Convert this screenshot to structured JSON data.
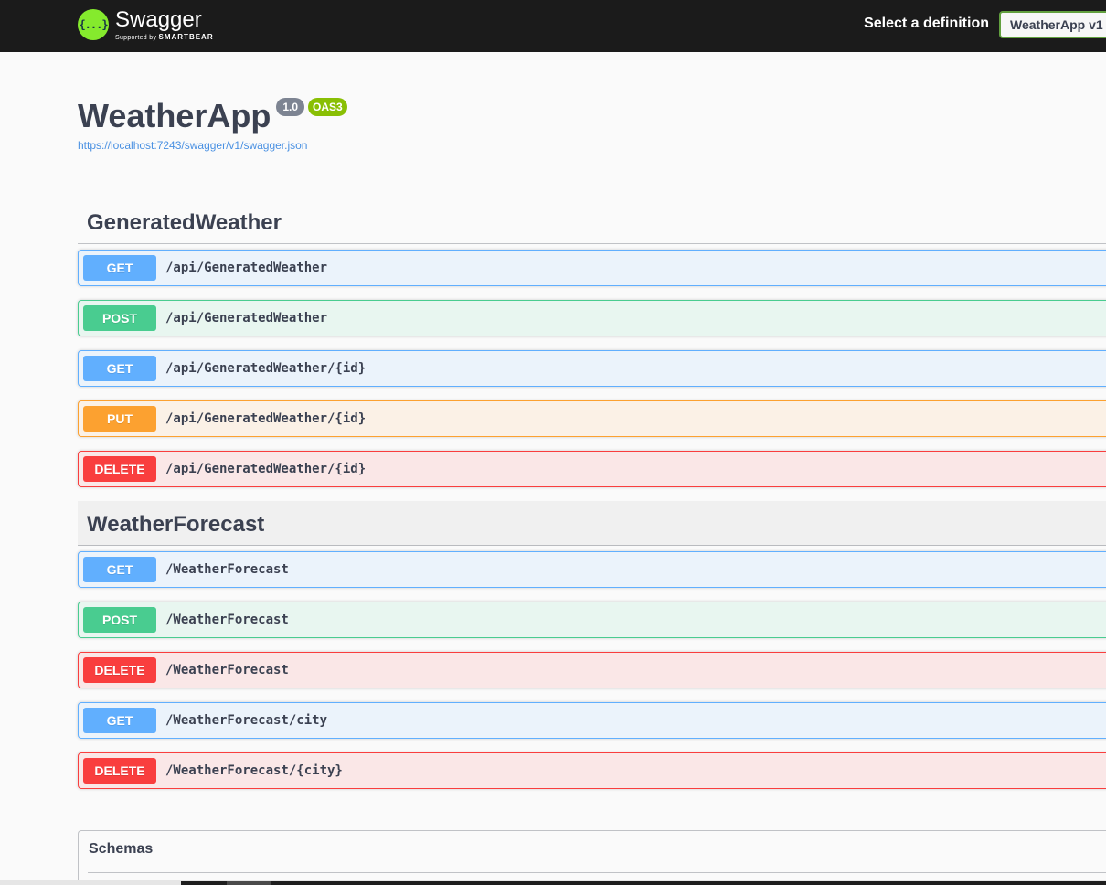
{
  "topbar": {
    "logo_text": "Swagger",
    "logo_glyph": "{...}",
    "logo_supported_by": "Supported by",
    "logo_sponsor": "SMARTBEAR",
    "select_label": "Select a definition",
    "selected_definition": "WeatherApp v1"
  },
  "info": {
    "title": "WeatherApp",
    "version": "1.0",
    "oas_badge": "OAS3",
    "spec_url": "https://localhost:7243/swagger/v1/swagger.json"
  },
  "tags": [
    {
      "name": "GeneratedWeather",
      "operations": [
        {
          "method": "GET",
          "path": "/api/GeneratedWeather"
        },
        {
          "method": "POST",
          "path": "/api/GeneratedWeather"
        },
        {
          "method": "GET",
          "path": "/api/GeneratedWeather/{id}"
        },
        {
          "method": "PUT",
          "path": "/api/GeneratedWeather/{id}"
        },
        {
          "method": "DELETE",
          "path": "/api/GeneratedWeather/{id}"
        }
      ]
    },
    {
      "name": "WeatherForecast",
      "operations": [
        {
          "method": "GET",
          "path": "/WeatherForecast"
        },
        {
          "method": "POST",
          "path": "/WeatherForecast"
        },
        {
          "method": "DELETE",
          "path": "/WeatherForecast"
        },
        {
          "method": "GET",
          "path": "/WeatherForecast/city"
        },
        {
          "method": "DELETE",
          "path": "/WeatherForecast/{city}"
        }
      ]
    }
  ],
  "schemas": {
    "title": "Schemas"
  },
  "colors": {
    "get": "#61affe",
    "post": "#49cc90",
    "put": "#fca130",
    "delete": "#f93e3e",
    "brand": "#85ea2d"
  }
}
